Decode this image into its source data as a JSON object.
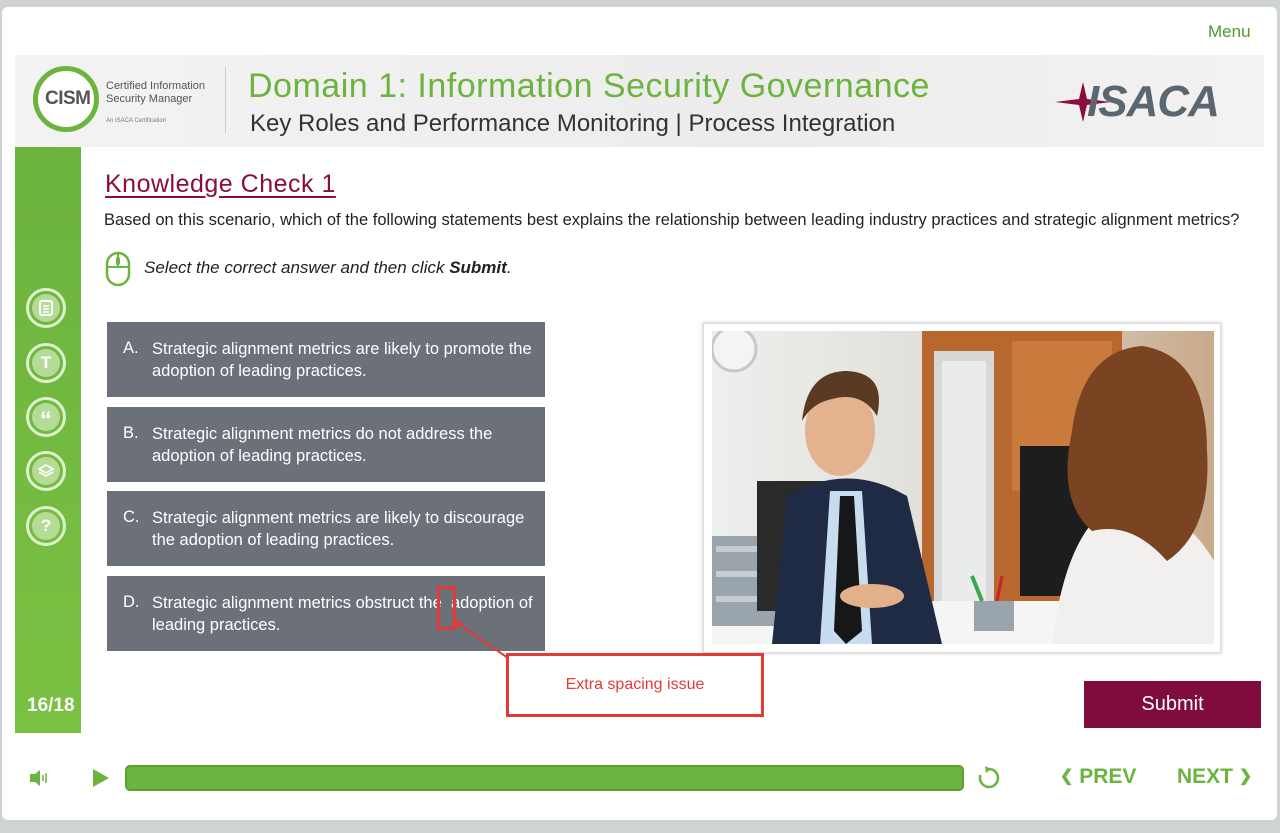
{
  "header": {
    "menu_label": "Menu",
    "logo": {
      "letters": "CISM",
      "line1": "Certified Information",
      "line2": "Security Manager",
      "tagline": "An ISACA Certification"
    },
    "domain_title": "Domain 1: Information Security Governance",
    "domain_subtitle": "Key Roles and Performance Monitoring | Process Integration",
    "brand_logo": "ISACA"
  },
  "sidebar": {
    "buttons": [
      {
        "name": "notes-icon"
      },
      {
        "name": "transcript-icon",
        "glyph": "T"
      },
      {
        "name": "quote-icon",
        "glyph": "“"
      },
      {
        "name": "resources-icon"
      },
      {
        "name": "help-icon",
        "glyph": "?"
      }
    ],
    "page_counter": "16/18"
  },
  "content": {
    "title": "Knowledge Check 1",
    "question": "Based on this scenario, which of the following statements best explains the relationship between leading industry practices and strategic alignment metrics?",
    "instruction_prefix": "Select the correct answer and then click ",
    "instruction_action": "Submit",
    "instruction_suffix": ".",
    "options": [
      {
        "letter": "A.",
        "text": "Strategic alignment metrics are likely to promote the adoption of leading practices."
      },
      {
        "letter": "B.",
        "text": "Strategic alignment metrics do not address the adoption of leading practices."
      },
      {
        "letter": "C.",
        "text": "Strategic alignment metrics are likely to discourage the adoption of leading practices."
      },
      {
        "letter": "D.",
        "text": "Strategic alignment metrics obstruct the  adoption of leading practices."
      }
    ],
    "submit_label": "Submit"
  },
  "annotation": {
    "label": "Extra spacing issue"
  },
  "footer": {
    "progress": 1.0,
    "prev_label": "PREV",
    "next_label": "NEXT"
  },
  "colors": {
    "brand_green": "#6cb33f",
    "accent_maroon": "#7f0c3c",
    "option_bg": "#6b7079",
    "annotation_red": "#e53935"
  }
}
